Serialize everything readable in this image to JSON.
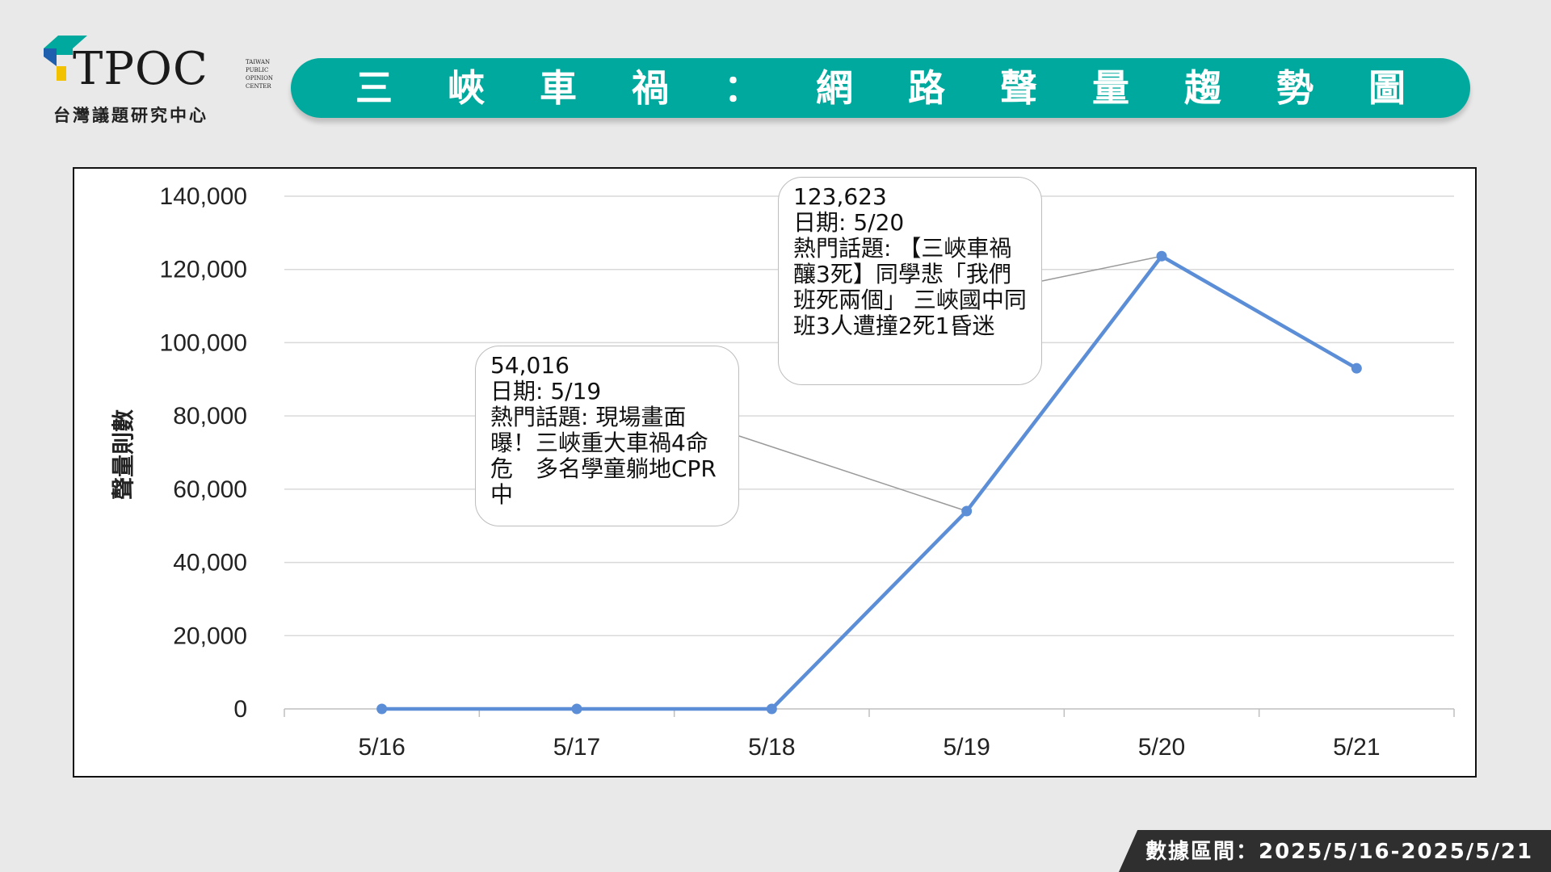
{
  "logo": {
    "brand": "TPOC",
    "sub_lines": [
      "TAIWAN",
      "PUBLIC",
      "OPINION",
      "CENTER"
    ],
    "chinese_name": "台灣議題研究中心"
  },
  "title": "三峽車禍：網路聲量趨勢圖",
  "footer": {
    "date_range": "數據區間：2025/5/16-2025/5/21"
  },
  "colors": {
    "banner": "#00a99d",
    "line": "#5b8ed6",
    "footer_band": "#2f2f2f"
  },
  "chart_data": {
    "type": "line",
    "x": [
      "5/16",
      "5/17",
      "5/18",
      "5/19",
      "5/20",
      "5/21"
    ],
    "series": [
      {
        "values": [
          0,
          0,
          0,
          54016,
          123623,
          93000
        ]
      }
    ],
    "ylabel": "聲量則數",
    "ylim": [
      0,
      140000
    ],
    "yticks": [
      "0",
      "20,000",
      "40,000",
      "60,000",
      "80,000",
      "100,000",
      "120,000",
      "140,000"
    ],
    "grid": true,
    "legend": "none",
    "annotations": [
      {
        "x": "5/19",
        "lines": [
          "54,016",
          "日期: 5/19",
          "熱門話題: 現場畫面曝！三峽重大車禍4命危　多名學童躺地CPR中"
        ]
      },
      {
        "x": "5/20",
        "lines": [
          "123,623",
          "日期: 5/20",
          "熱門話題: 【三峽車禍釀3死】同學悲「我們班死兩個」 三峽國中同班3人遭撞2死1昏迷"
        ]
      }
    ]
  }
}
